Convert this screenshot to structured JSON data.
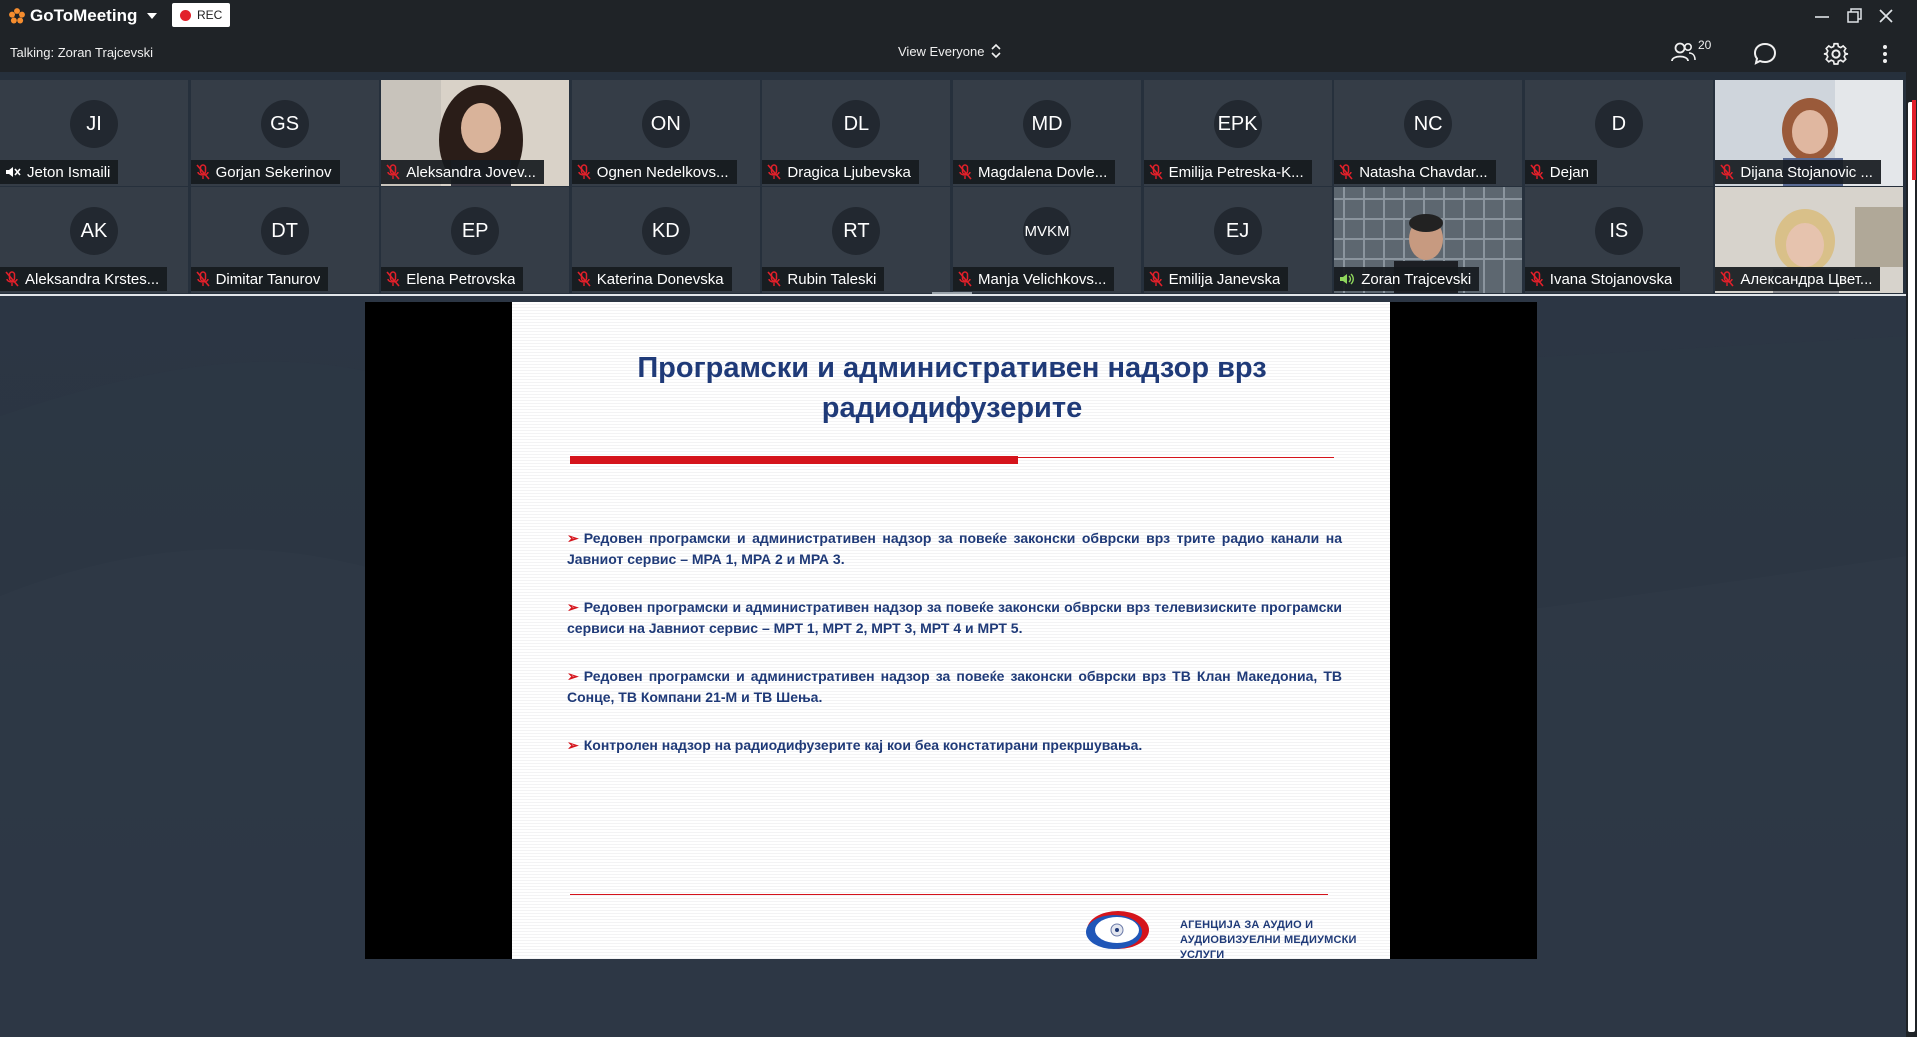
{
  "app": {
    "brand": "GoToMeeting",
    "rec_label": "REC"
  },
  "controls": {
    "talking": "Talking: Zoran Trajcevski",
    "view_label": "View Everyone",
    "attendee_count": "20"
  },
  "participants": [
    {
      "initials": "JI",
      "name": "Jeton Ismaili",
      "status": "muted-speaker"
    },
    {
      "initials": "GS",
      "name": "Gorjan Sekerinov",
      "status": "mic-off"
    },
    {
      "initials": "",
      "name": "Aleksandra Jovev...",
      "status": "mic-off",
      "video": true
    },
    {
      "initials": "ON",
      "name": "Ognen Nedelkovs...",
      "status": "mic-off"
    },
    {
      "initials": "DL",
      "name": "Dragica Ljubevska",
      "status": "mic-off"
    },
    {
      "initials": "MD",
      "name": "Magdalena Dovle...",
      "status": "mic-off"
    },
    {
      "initials": "EPK",
      "name": "Emilija Petreska-K...",
      "status": "mic-off"
    },
    {
      "initials": "NC",
      "name": "Natasha Chavdar...",
      "status": "mic-off"
    },
    {
      "initials": "D",
      "name": "Dejan",
      "status": "mic-off"
    },
    {
      "initials": "",
      "name": "Dijana Stojanovic ...",
      "status": "mic-off",
      "video": true
    },
    {
      "initials": "AK",
      "name": "Aleksandra Krstes...",
      "status": "mic-off"
    },
    {
      "initials": "DT",
      "name": "Dimitar Tanurov",
      "status": "mic-off"
    },
    {
      "initials": "EP",
      "name": "Elena Petrovska",
      "status": "mic-off"
    },
    {
      "initials": "KD",
      "name": "Katerina Donevska",
      "status": "mic-off"
    },
    {
      "initials": "RT",
      "name": "Rubin Taleski",
      "status": "mic-off"
    },
    {
      "initials": "MVKM",
      "name": "Manja Velichkovs...",
      "status": "mic-off"
    },
    {
      "initials": "EJ",
      "name": "Emilija Janevska",
      "status": "mic-off"
    },
    {
      "initials": "",
      "name": "Zoran Trajcevski",
      "status": "speaking",
      "video": true
    },
    {
      "initials": "IS",
      "name": "Ivana Stojanovska",
      "status": "mic-off"
    },
    {
      "initials": "",
      "name": "Александра Цвет...",
      "status": "mic-off",
      "video": true
    }
  ],
  "slide": {
    "title_line1": "Програмски и административен надзор врз",
    "title_line2": "радиодифузерите",
    "bullets": [
      "Редовен програмски и административен надзор за повеќе законски обврски врз трите радио канали на Јавниот сервис – МРА 1, МРА 2 и МРА 3.",
      "Редовен програмски и административен надзор за повеќе законски обврски врз телевизиските програмски сервиси на Јавниот сервис – МРТ 1, МРТ 2, МРТ 3, МРТ 4 и МРТ 5.",
      "Редовен програмски и административен надзор за повеќе законски обврски врз ТВ Клан Македониа, ТВ Сонце, ТВ Компани 21-М и ТВ Шења.",
      "Контролен надзор на радиодифузерите кај кои беа констатирани прекршувања."
    ],
    "bullet_marker": "➢",
    "agency_line1": "АГЕНЦИЈА ЗА АУДИО И",
    "agency_line2": "АУДИОВИЗУЕЛНИ МЕДИУМСКИ УСЛУГИ"
  },
  "colors": {
    "accent_red": "#d5141c",
    "slide_blue": "#1f3a78",
    "speaking_green": "#8fd65c",
    "rec_red": "#e2202a"
  }
}
